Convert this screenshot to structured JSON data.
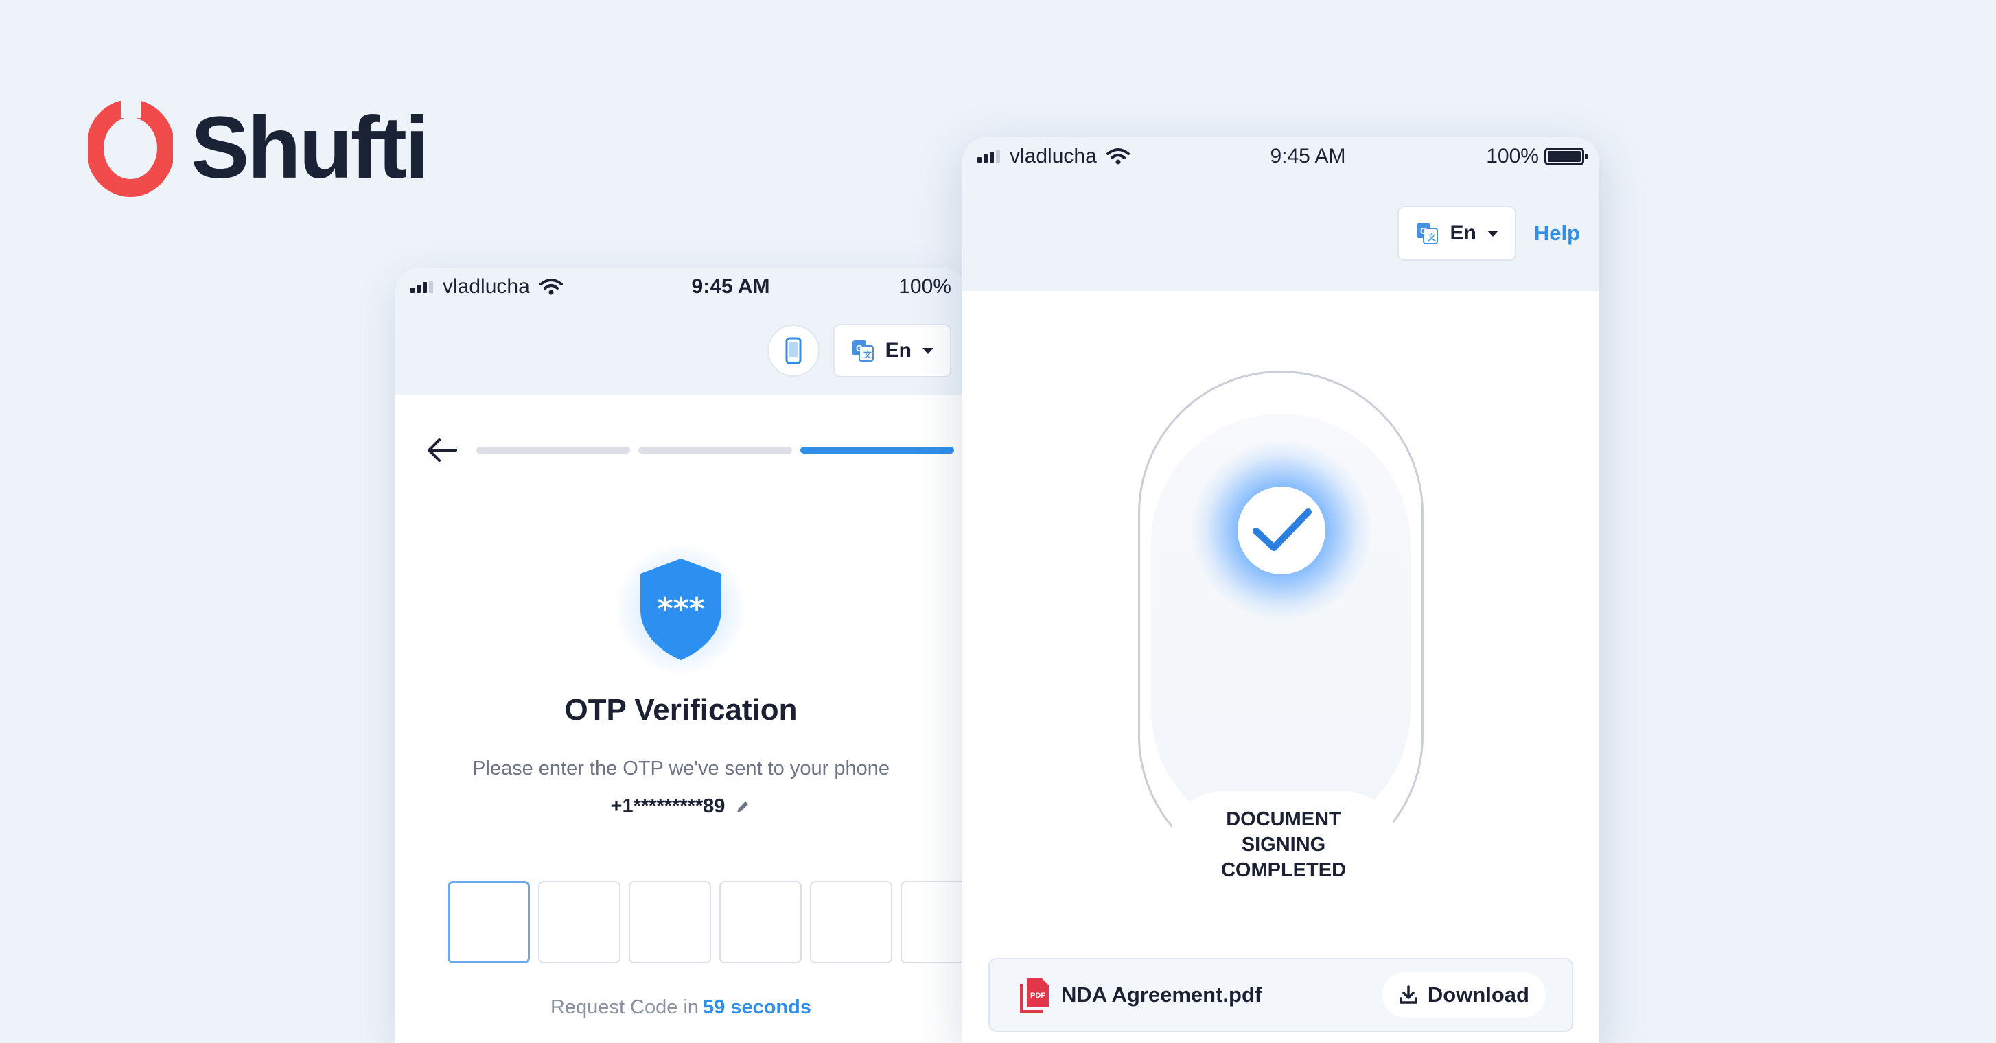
{
  "brand": {
    "name": "Shufti",
    "accent": "#f04a4a"
  },
  "otp_screen": {
    "status": {
      "carrier": "vladlucha",
      "time": "9:45 AM",
      "battery": "100%"
    },
    "language": "En",
    "progress": {
      "steps": 3,
      "active_step": 3
    },
    "shield_text": "***",
    "title": "OTP Verification",
    "subtitle": "Please enter the OTP we've sent to your phone",
    "phone_number": "+1*********89",
    "otp_boxes": 6,
    "request_prefix": "Request Code in",
    "request_seconds": "59 seconds"
  },
  "sign_screen": {
    "status": {
      "carrier": "vladlucha",
      "time": "9:45 AM",
      "battery": "100%"
    },
    "language": "En",
    "help": "Help",
    "completed_text": "DOCUMENT SIGNING COMPLETED",
    "file_name": "NDA Agreement.pdf",
    "download_label": "Download"
  },
  "colors": {
    "primary": "#2f8fe8",
    "background": "#eef3fa",
    "pdf": "#e2364a"
  }
}
